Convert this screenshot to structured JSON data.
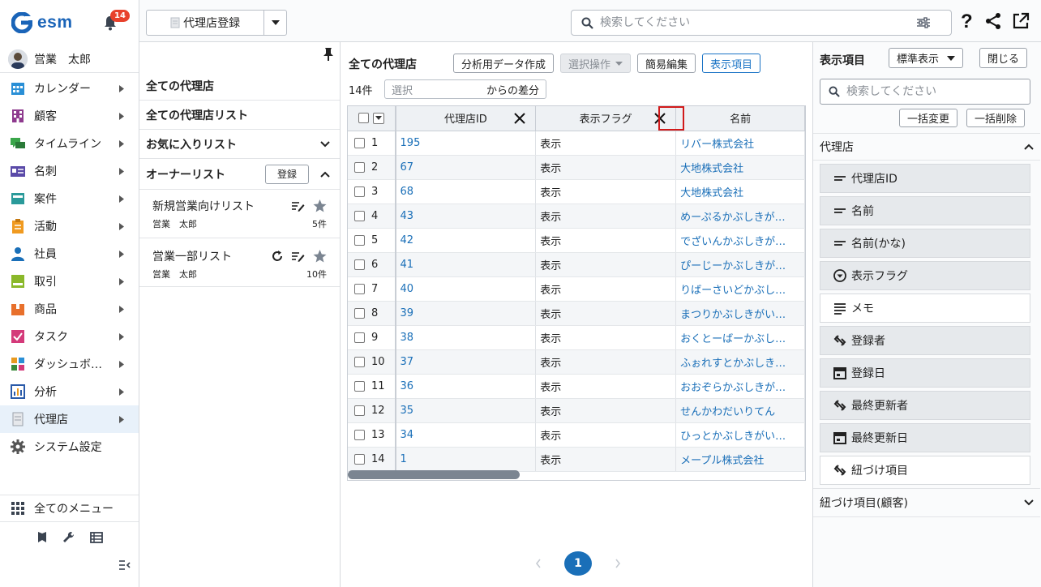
{
  "app": {
    "logo_text": "esm",
    "notification_count": "14",
    "user_name": "営業　太郎"
  },
  "nav": [
    {
      "label": "カレンダー",
      "icon": "calendar-icon",
      "color": "#2a8fd6"
    },
    {
      "label": "顧客",
      "icon": "building-icon",
      "color": "#8e3a8e"
    },
    {
      "label": "タイムライン",
      "icon": "chat-icon",
      "color": "#3aa64a"
    },
    {
      "label": "名刺",
      "icon": "card-icon",
      "color": "#5a4aa8"
    },
    {
      "label": "案件",
      "icon": "folder-icon",
      "color": "#2a9a9a"
    },
    {
      "label": "活動",
      "icon": "clipboard-icon",
      "color": "#f09a20"
    },
    {
      "label": "社員",
      "icon": "person-icon",
      "color": "#1a6fb8"
    },
    {
      "label": "取引",
      "icon": "deal-icon",
      "color": "#8ab82a"
    },
    {
      "label": "商品",
      "icon": "box-icon",
      "color": "#e8702c"
    },
    {
      "label": "タスク",
      "icon": "task-icon",
      "color": "#d43a7a"
    },
    {
      "label": "ダッシュボ…",
      "icon": "dashboard-icon",
      "color": "#3a8a3a"
    },
    {
      "label": "分析",
      "icon": "chart-icon",
      "color": "#2a5aa8"
    },
    {
      "label": "代理店",
      "icon": "document-icon",
      "color": "#9aa1aa"
    },
    {
      "label": "システム設定",
      "icon": "gear-icon",
      "color": "#555"
    }
  ],
  "all_menu": "全てのメニュー",
  "toolbar": {
    "register_label": "代理店登録",
    "search_placeholder": "検索してください"
  },
  "list_panel": {
    "items": [
      "全ての代理店",
      "全ての代理店リスト",
      "お気に入りリスト"
    ],
    "owner_list": "オーナーリスト",
    "owner_register": "登録",
    "lists": [
      {
        "title": "新規営業向けリスト",
        "owner": "営業　太郎",
        "count": "5件"
      },
      {
        "title": "営業一部リスト",
        "owner": "営業　太郎",
        "count": "10件"
      }
    ]
  },
  "main": {
    "title": "全ての代理店",
    "btn_analysis": "分析用データ作成",
    "btn_select": "選択操作",
    "btn_edit": "簡易編集",
    "btn_display": "表示項目",
    "count": "14件",
    "diff_placeholder": "選択",
    "diff_suffix": "からの差分"
  },
  "table": {
    "columns": [
      "代理店ID",
      "表示フラグ",
      "名前"
    ],
    "rows": [
      {
        "n": "1",
        "id": "195",
        "flag": "表示",
        "name": "リバー株式会社"
      },
      {
        "n": "2",
        "id": "67",
        "flag": "表示",
        "name": "大地株式会社"
      },
      {
        "n": "3",
        "id": "68",
        "flag": "表示",
        "name": "大地株式会社"
      },
      {
        "n": "4",
        "id": "43",
        "flag": "表示",
        "name": "めーぷるかぶしきが…"
      },
      {
        "n": "5",
        "id": "42",
        "flag": "表示",
        "name": "でざいんかぶしきが…"
      },
      {
        "n": "6",
        "id": "41",
        "flag": "表示",
        "name": "ぴーじーかぶしきが…"
      },
      {
        "n": "7",
        "id": "40",
        "flag": "表示",
        "name": "りばーさいどかぶし…"
      },
      {
        "n": "8",
        "id": "39",
        "flag": "表示",
        "name": "まつりかぶしきがい…"
      },
      {
        "n": "9",
        "id": "38",
        "flag": "表示",
        "name": "おくとーばーかぶし…"
      },
      {
        "n": "10",
        "id": "37",
        "flag": "表示",
        "name": "ふぉれすとかぶしき…"
      },
      {
        "n": "11",
        "id": "36",
        "flag": "表示",
        "name": "おおぞらかぶしきが…"
      },
      {
        "n": "12",
        "id": "35",
        "flag": "表示",
        "name": "せんかわだいりてん"
      },
      {
        "n": "13",
        "id": "34",
        "flag": "表示",
        "name": "ひっとかぶしきがい…"
      },
      {
        "n": "14",
        "id": "1",
        "flag": "表示",
        "name": "メープル株式会社"
      }
    ]
  },
  "pagination": {
    "current": "1"
  },
  "right_panel": {
    "title": "表示項目",
    "preset": "標準表示",
    "close": "閉じる",
    "search_placeholder": "検索してください",
    "bulk_change": "一括変更",
    "bulk_delete": "一括削除",
    "section": "代理店",
    "fields": [
      {
        "label": "代理店ID",
        "icon": "text-line-icon",
        "selected": true
      },
      {
        "label": "名前",
        "icon": "text-line-icon",
        "selected": true
      },
      {
        "label": "名前(かな)",
        "icon": "text-line-icon",
        "selected": true
      },
      {
        "label": "表示フラグ",
        "icon": "dropdown-circle-icon",
        "selected": true
      },
      {
        "label": "メモ",
        "icon": "text-multiline-icon",
        "selected": false
      },
      {
        "label": "登録者",
        "icon": "link-icon",
        "selected": true
      },
      {
        "label": "登録日",
        "icon": "calendar-icon",
        "selected": true
      },
      {
        "label": "最終更新者",
        "icon": "link-icon",
        "selected": true
      },
      {
        "label": "最終更新日",
        "icon": "calendar-icon",
        "selected": true
      },
      {
        "label": "紐づけ項目",
        "icon": "link-icon",
        "selected": false
      }
    ],
    "section2": "紐づけ項目(顧客)"
  }
}
